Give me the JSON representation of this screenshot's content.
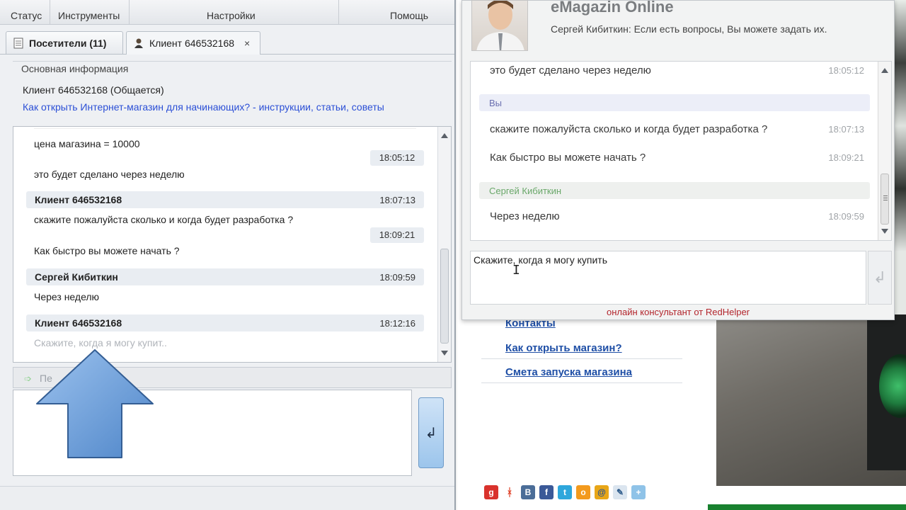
{
  "operator_app": {
    "menu": [
      "Статус",
      "Инструменты",
      "Настройки",
      "Помощь"
    ],
    "tabs": [
      {
        "label": "Посетители (11)",
        "icon": "document-icon"
      },
      {
        "label": "Клиент 646532168",
        "icon": "user-icon",
        "close": "×"
      }
    ],
    "info": {
      "legend": "Основная информация",
      "status": "Клиент 646532168 (Общается)",
      "link": "Как открыть Интернет-магазин для начинающих? - инструкции, статьи, советы"
    },
    "chat": {
      "line1": "цена магазина = 10000",
      "time1": "18:05:12",
      "line2": "это будет сделано через неделю",
      "head1": {
        "name": "Клиент 646532168",
        "time": "18:07:13"
      },
      "line3": "скажите пожалуйста сколько и когда будет разработка ?",
      "time2": "18:09:21",
      "line4": "Как быстро вы можете начать ?",
      "head2": {
        "name": "Сергей Кибиткин",
        "time": "18:09:59"
      },
      "line5": "Через неделю",
      "head3": {
        "name": "Клиент 646532168",
        "time": "18:12:16"
      },
      "typing": "Скажите, когда я могу купит.."
    },
    "quick_bar_label": "Пе",
    "send_icon": "↲",
    "colors": {
      "link": "#2b4fd6",
      "header_bg": "#e9edf2",
      "send_button": "#9cc5ec"
    }
  },
  "widget": {
    "title": "eMagazin Online",
    "subtitle": "Сергей Кибиткин: Если есть вопросы, Вы можете задать их.",
    "messages": {
      "m1": {
        "text": "это будет сделано через неделю",
        "time": "18:05:12"
      },
      "head_you": "Вы",
      "m2": {
        "text": "скажите пожалуйста сколько и когда будет разработка ?",
        "time": "18:07:13"
      },
      "m3": {
        "text": "Как быстро вы можете начать ?",
        "time": "18:09:21"
      },
      "head_op": "Сергей Кибиткин",
      "m4": {
        "text": "Через неделю",
        "time": "18:09:59"
      }
    },
    "input_value": "Скажите, когда я могу купить",
    "send_icon": "↲",
    "powered_by": "онлайн консультант от RedHelper",
    "colors": {
      "powered": "#b3262d",
      "operator_name": "#6aa86a",
      "you_label": "#6a6fb0"
    }
  },
  "page": {
    "links": [
      "Контакты",
      "Как открыть магазин?",
      "Смета запуска магазина"
    ],
    "social_icons": [
      "google-plus-icon",
      "moikrug-icon",
      "vkontakte-icon",
      "facebook-icon",
      "twitter-icon",
      "odnoklassniki-icon",
      "mail-ru-icon",
      "livejournal-icon",
      "more-icon"
    ],
    "link_color": "#1f4fa6"
  }
}
